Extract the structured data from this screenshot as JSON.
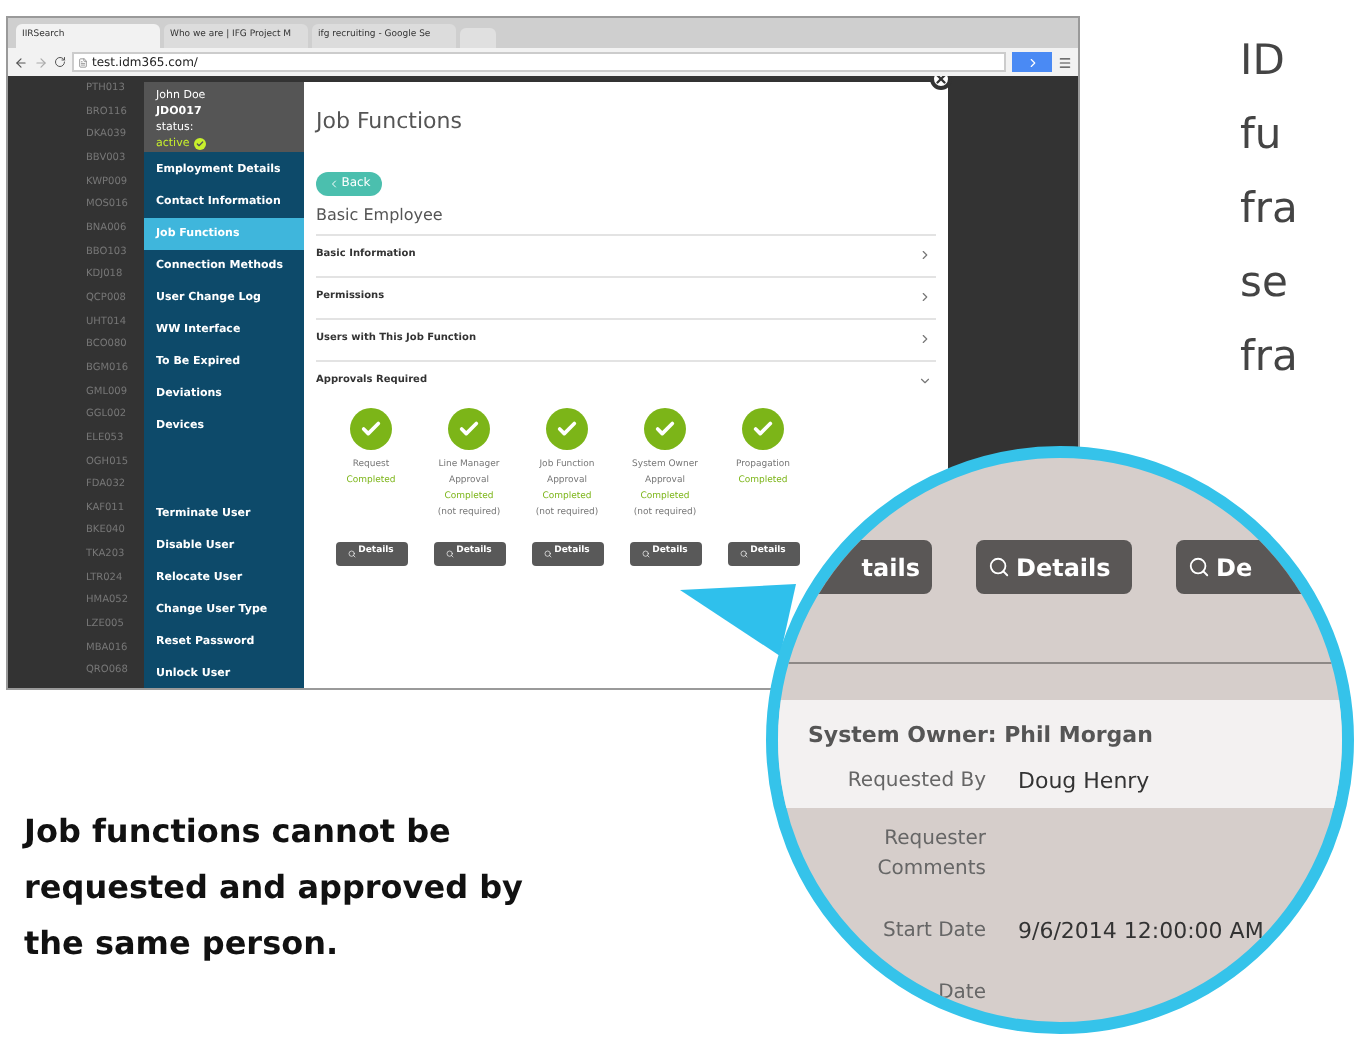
{
  "browser": {
    "tabs": [
      {
        "title": "IIRSearch",
        "selected": true
      },
      {
        "title": "Who we are | IFG Project M",
        "selected": false
      },
      {
        "title": "ifg recruiting - Google Se",
        "selected": false
      }
    ],
    "address": "test.idm365.com/"
  },
  "user_codes": [
    "PTH013",
    "BRO116",
    "DKA039",
    "BBV003",
    "KWP009",
    "MOS016",
    "BNA006",
    "BBO103",
    "KDJ018",
    "QCP008",
    "UHT014",
    "BCO080",
    "BGM016",
    "GML009",
    "GGL002",
    "ELE053",
    "OGH015",
    "FDA032",
    "KAF011",
    "BKE040",
    "TKA203",
    "LTR024",
    "HMA052",
    "LZE005",
    "MBA016",
    "QRO068"
  ],
  "user": {
    "name": "John Doe",
    "id": "JDO017",
    "status_label": "status:",
    "status": "active"
  },
  "nav_items": [
    {
      "label": "Employment Details",
      "selected": false
    },
    {
      "label": "Contact Information",
      "selected": false
    },
    {
      "label": "Job Functions",
      "selected": true
    },
    {
      "label": "Connection Methods",
      "selected": false
    },
    {
      "label": "User Change Log",
      "selected": false
    },
    {
      "label": "WW Interface",
      "selected": false
    },
    {
      "label": "To Be Expired",
      "selected": false
    },
    {
      "label": "Deviations",
      "selected": false
    },
    {
      "label": "Devices",
      "selected": false
    }
  ],
  "action_items": [
    "Terminate User",
    "Disable User",
    "Relocate User",
    "Change User Type",
    "Reset Password",
    "Unlock User"
  ],
  "page_title": "Job Functions",
  "back_button": "Back",
  "job_function": "Basic Employee",
  "sections": [
    {
      "title": "Basic Information",
      "expanded": false
    },
    {
      "title": "Permissions",
      "expanded": false
    },
    {
      "title": "Users with This Job Function",
      "expanded": false
    },
    {
      "title": "Approvals Required",
      "expanded": true
    }
  ],
  "approval_steps": [
    {
      "label_lines": [
        "Request"
      ],
      "status": "Completed",
      "done": true,
      "button": "Details"
    },
    {
      "label_lines": [
        "Line Manager",
        "Approval"
      ],
      "status": "Completed",
      "note": "(not required)",
      "done": true,
      "button": "Details"
    },
    {
      "label_lines": [
        "Job Function",
        "Approval"
      ],
      "status": "Completed",
      "note": "(not required)",
      "done": true,
      "button": "Details"
    },
    {
      "label_lines": [
        "System Owner",
        "Approval"
      ],
      "status": "Completed",
      "note": "(not required)",
      "done": true,
      "button": "Details"
    },
    {
      "label_lines": [
        "Propagation"
      ],
      "status": "Completed",
      "done": true,
      "button": "Details"
    }
  ],
  "magnifier": {
    "buttons": [
      "tails",
      "Details",
      "De"
    ],
    "heading": "System Owner: Phil Morgan",
    "fields": [
      {
        "label": "Requested By",
        "value": "Doug Henry",
        "highlighted": true
      },
      {
        "label": "Requester Comments",
        "highlighted": false
      },
      {
        "label": "Start Date",
        "value": "9/6/2014 12:00:00 AM",
        "highlighted": false
      },
      {
        "label": "Date",
        "highlighted": false
      }
    ]
  },
  "side_text_lines": [
    "ID",
    "fu",
    "fra",
    "se",
    "fra"
  ],
  "caption": "Job functions cannot be requested and approved by the same person."
}
